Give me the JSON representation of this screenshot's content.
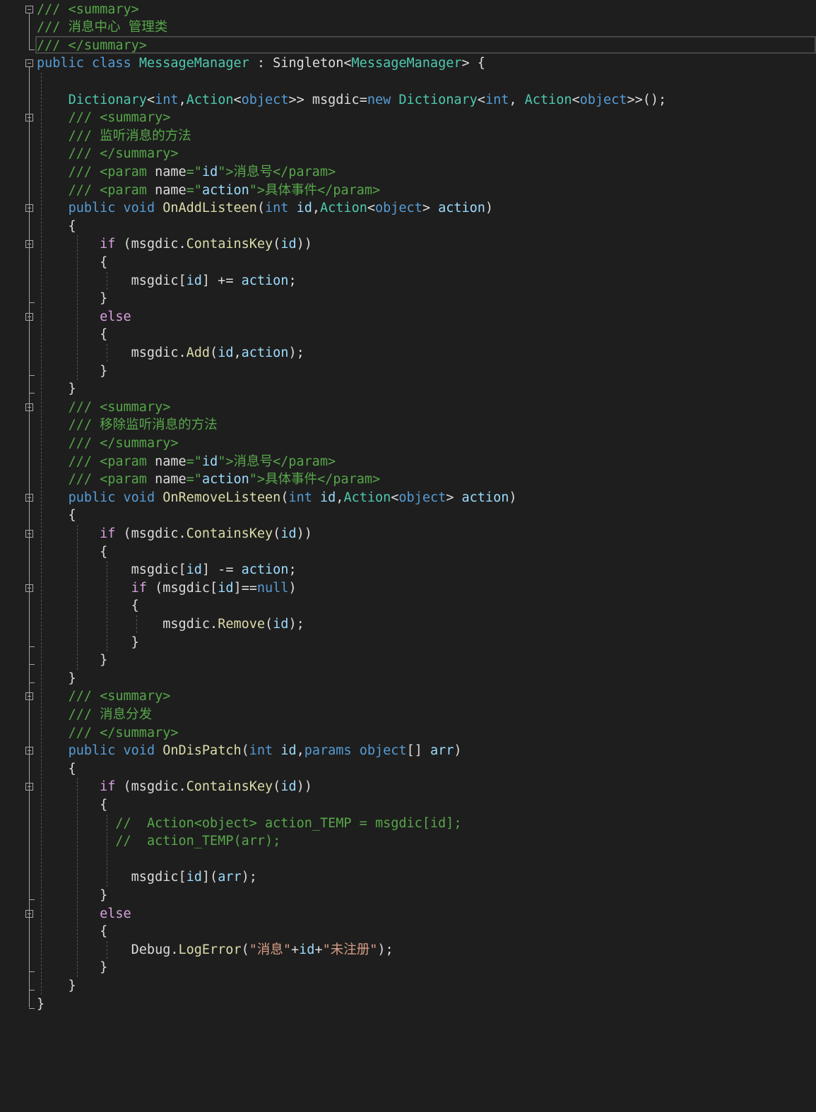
{
  "editor": {
    "language": "C#",
    "theme_colors": {
      "background": "#1e1e1e",
      "keyword": "#569cd6",
      "control_keyword": "#d8a0df",
      "type": "#4ec9b0",
      "method": "#dcdcaa",
      "parameter": "#9cdcfe",
      "comment": "#57a64a",
      "doc_comment_tag": "#608b4e",
      "string": "#d69d85",
      "plain": "#dcdcdc"
    },
    "lines": [
      [
        [
          "c",
          "/// <summary>"
        ]
      ],
      [
        [
          "c",
          "/// 消息中心 管理类"
        ]
      ],
      [
        [
          "c",
          "/// </summary>"
        ]
      ],
      [
        [
          "k",
          "public"
        ],
        [
          "p",
          " "
        ],
        [
          "k",
          "class"
        ],
        [
          "p",
          " "
        ],
        [
          "t",
          "MessageManager"
        ],
        [
          "p",
          " : Singleton<"
        ],
        [
          "t",
          "MessageManager"
        ],
        [
          "p",
          "> {"
        ]
      ],
      [
        [
          "p",
          ""
        ]
      ],
      [
        [
          "p",
          "    "
        ],
        [
          "t",
          "Dictionary"
        ],
        [
          "p",
          "<"
        ],
        [
          "k",
          "int"
        ],
        [
          "p",
          ","
        ],
        [
          "t",
          "Action"
        ],
        [
          "p",
          "<"
        ],
        [
          "k",
          "object"
        ],
        [
          "p",
          ">> msgdic="
        ],
        [
          "k",
          "new"
        ],
        [
          "p",
          " "
        ],
        [
          "t",
          "Dictionary"
        ],
        [
          "p",
          "<"
        ],
        [
          "k",
          "int"
        ],
        [
          "p",
          ", "
        ],
        [
          "t",
          "Action"
        ],
        [
          "p",
          "<"
        ],
        [
          "k",
          "object"
        ],
        [
          "p",
          ">>();"
        ]
      ],
      [
        [
          "p",
          "    "
        ],
        [
          "c",
          "/// <summary>"
        ]
      ],
      [
        [
          "p",
          "    "
        ],
        [
          "c",
          "/// 监听消息的方法"
        ]
      ],
      [
        [
          "p",
          "    "
        ],
        [
          "c",
          "/// </summary>"
        ]
      ],
      [
        [
          "p",
          "    "
        ],
        [
          "c",
          "/// <param "
        ],
        [
          "g",
          "name"
        ],
        [
          "c",
          "=\""
        ],
        [
          "v",
          "id"
        ],
        [
          "c",
          "\">消息号</param>"
        ]
      ],
      [
        [
          "p",
          "    "
        ],
        [
          "c",
          "/// <param "
        ],
        [
          "g",
          "name"
        ],
        [
          "c",
          "=\""
        ],
        [
          "v",
          "action"
        ],
        [
          "c",
          "\">具体事件</param>"
        ]
      ],
      [
        [
          "p",
          "    "
        ],
        [
          "k",
          "public"
        ],
        [
          "p",
          " "
        ],
        [
          "k",
          "void"
        ],
        [
          "p",
          " "
        ],
        [
          "m",
          "OnAddListeen"
        ],
        [
          "p",
          "("
        ],
        [
          "k",
          "int"
        ],
        [
          "p",
          " "
        ],
        [
          "v",
          "id"
        ],
        [
          "p",
          ","
        ],
        [
          "t",
          "Action"
        ],
        [
          "p",
          "<"
        ],
        [
          "k",
          "object"
        ],
        [
          "p",
          "> "
        ],
        [
          "v",
          "action"
        ],
        [
          "p",
          ")"
        ]
      ],
      [
        [
          "p",
          "    {"
        ]
      ],
      [
        [
          "p",
          "        "
        ],
        [
          "x",
          "if"
        ],
        [
          "p",
          " (msgdic."
        ],
        [
          "m",
          "ContainsKey"
        ],
        [
          "p",
          "("
        ],
        [
          "v",
          "id"
        ],
        [
          "p",
          "))"
        ]
      ],
      [
        [
          "p",
          "        {"
        ]
      ],
      [
        [
          "p",
          "            msgdic["
        ],
        [
          "v",
          "id"
        ],
        [
          "p",
          "] += "
        ],
        [
          "v",
          "action"
        ],
        [
          "p",
          ";"
        ]
      ],
      [
        [
          "p",
          "        }"
        ]
      ],
      [
        [
          "p",
          "        "
        ],
        [
          "x",
          "else"
        ]
      ],
      [
        [
          "p",
          "        {"
        ]
      ],
      [
        [
          "p",
          "            msgdic."
        ],
        [
          "m",
          "Add"
        ],
        [
          "p",
          "("
        ],
        [
          "v",
          "id"
        ],
        [
          "p",
          ","
        ],
        [
          "v",
          "action"
        ],
        [
          "p",
          ");"
        ]
      ],
      [
        [
          "p",
          "        }"
        ]
      ],
      [
        [
          "p",
          "    }"
        ]
      ],
      [
        [
          "p",
          "    "
        ],
        [
          "c",
          "/// <summary>"
        ]
      ],
      [
        [
          "p",
          "    "
        ],
        [
          "c",
          "/// 移除监听消息的方法"
        ]
      ],
      [
        [
          "p",
          "    "
        ],
        [
          "c",
          "/// </summary>"
        ]
      ],
      [
        [
          "p",
          "    "
        ],
        [
          "c",
          "/// <param "
        ],
        [
          "g",
          "name"
        ],
        [
          "c",
          "=\""
        ],
        [
          "v",
          "id"
        ],
        [
          "c",
          "\">消息号</param>"
        ]
      ],
      [
        [
          "p",
          "    "
        ],
        [
          "c",
          "/// <param "
        ],
        [
          "g",
          "name"
        ],
        [
          "c",
          "=\""
        ],
        [
          "v",
          "action"
        ],
        [
          "c",
          "\">具体事件</param>"
        ]
      ],
      [
        [
          "p",
          "    "
        ],
        [
          "k",
          "public"
        ],
        [
          "p",
          " "
        ],
        [
          "k",
          "void"
        ],
        [
          "p",
          " "
        ],
        [
          "m",
          "OnRemoveListeen"
        ],
        [
          "p",
          "("
        ],
        [
          "k",
          "int"
        ],
        [
          "p",
          " "
        ],
        [
          "v",
          "id"
        ],
        [
          "p",
          ","
        ],
        [
          "t",
          "Action"
        ],
        [
          "p",
          "<"
        ],
        [
          "k",
          "object"
        ],
        [
          "p",
          "> "
        ],
        [
          "v",
          "action"
        ],
        [
          "p",
          ")"
        ]
      ],
      [
        [
          "p",
          "    {"
        ]
      ],
      [
        [
          "p",
          "        "
        ],
        [
          "x",
          "if"
        ],
        [
          "p",
          " (msgdic."
        ],
        [
          "m",
          "ContainsKey"
        ],
        [
          "p",
          "("
        ],
        [
          "v",
          "id"
        ],
        [
          "p",
          "))"
        ]
      ],
      [
        [
          "p",
          "        {"
        ]
      ],
      [
        [
          "p",
          "            msgdic["
        ],
        [
          "v",
          "id"
        ],
        [
          "p",
          "] -= "
        ],
        [
          "v",
          "action"
        ],
        [
          "p",
          ";"
        ]
      ],
      [
        [
          "p",
          "            "
        ],
        [
          "x",
          "if"
        ],
        [
          "p",
          " (msgdic["
        ],
        [
          "v",
          "id"
        ],
        [
          "p",
          "]=="
        ],
        [
          "k",
          "null"
        ],
        [
          "p",
          ")"
        ]
      ],
      [
        [
          "p",
          "            {"
        ]
      ],
      [
        [
          "p",
          "                msgdic."
        ],
        [
          "m",
          "Remove"
        ],
        [
          "p",
          "("
        ],
        [
          "v",
          "id"
        ],
        [
          "p",
          ");"
        ]
      ],
      [
        [
          "p",
          "            }"
        ]
      ],
      [
        [
          "p",
          "        }"
        ]
      ],
      [
        [
          "p",
          "    }"
        ]
      ],
      [
        [
          "p",
          "    "
        ],
        [
          "c",
          "/// <summary>"
        ]
      ],
      [
        [
          "p",
          "    "
        ],
        [
          "c",
          "/// 消息分发"
        ]
      ],
      [
        [
          "p",
          "    "
        ],
        [
          "c",
          "/// </summary>"
        ]
      ],
      [
        [
          "p",
          "    "
        ],
        [
          "k",
          "public"
        ],
        [
          "p",
          " "
        ],
        [
          "k",
          "void"
        ],
        [
          "p",
          " "
        ],
        [
          "m",
          "OnDisPatch"
        ],
        [
          "p",
          "("
        ],
        [
          "k",
          "int"
        ],
        [
          "p",
          " "
        ],
        [
          "v",
          "id"
        ],
        [
          "p",
          ","
        ],
        [
          "k",
          "params"
        ],
        [
          "p",
          " "
        ],
        [
          "k",
          "object"
        ],
        [
          "p",
          "[] "
        ],
        [
          "v",
          "arr"
        ],
        [
          "p",
          ")"
        ]
      ],
      [
        [
          "p",
          "    {"
        ]
      ],
      [
        [
          "p",
          "        "
        ],
        [
          "x",
          "if"
        ],
        [
          "p",
          " (msgdic."
        ],
        [
          "m",
          "ContainsKey"
        ],
        [
          "p",
          "("
        ],
        [
          "v",
          "id"
        ],
        [
          "p",
          "))"
        ]
      ],
      [
        [
          "p",
          "        {"
        ]
      ],
      [
        [
          "p",
          "          "
        ],
        [
          "c",
          "//  Action<object> action_TEMP = msgdic[id];"
        ]
      ],
      [
        [
          "p",
          "          "
        ],
        [
          "c",
          "//  action_TEMP(arr);"
        ]
      ],
      [
        [
          "p",
          ""
        ]
      ],
      [
        [
          "p",
          "            msgdic["
        ],
        [
          "v",
          "id"
        ],
        [
          "p",
          "]("
        ],
        [
          "v",
          "arr"
        ],
        [
          "p",
          ");"
        ]
      ],
      [
        [
          "p",
          "        }"
        ]
      ],
      [
        [
          "p",
          "        "
        ],
        [
          "x",
          "else"
        ]
      ],
      [
        [
          "p",
          "        {"
        ]
      ],
      [
        [
          "p",
          "            Debug."
        ],
        [
          "m",
          "LogError"
        ],
        [
          "p",
          "("
        ],
        [
          "s",
          "\"消息\""
        ],
        [
          "p",
          "+"
        ],
        [
          "v",
          "id"
        ],
        [
          "p",
          "+"
        ],
        [
          "s",
          "\"未注册\""
        ],
        [
          "p",
          ");"
        ]
      ],
      [
        [
          "p",
          "        }"
        ]
      ],
      [
        [
          "p",
          "    }"
        ]
      ],
      [
        [
          "p",
          "}"
        ]
      ]
    ]
  }
}
